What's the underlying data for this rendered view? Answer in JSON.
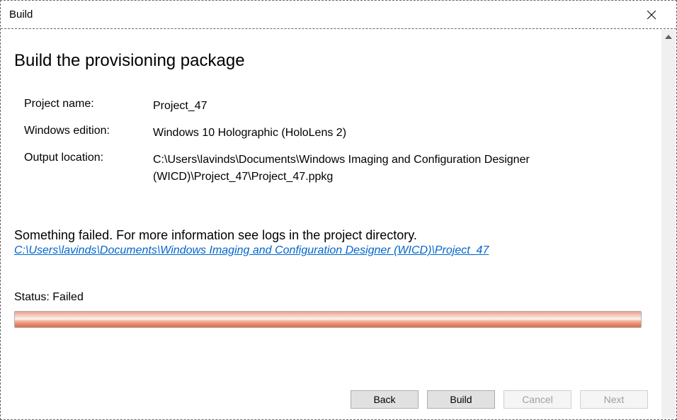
{
  "window": {
    "title": "Build"
  },
  "heading": "Build the provisioning package",
  "info": {
    "project_name_label": "Project name:",
    "project_name_value": "Project_47",
    "windows_edition_label": "Windows edition:",
    "windows_edition_value": "Windows 10 Holographic (HoloLens 2)",
    "output_location_label": "Output location:",
    "output_location_value": "C:\\Users\\lavinds\\Documents\\Windows Imaging and Configuration Designer (WICD)\\Project_47\\Project_47.ppkg"
  },
  "error": {
    "message": "Something failed. For more information see logs in the project directory.",
    "log_link": "C:\\Users\\lavinds\\Documents\\Windows Imaging and Configuration Designer (WICD)\\Project_47"
  },
  "status": {
    "label": "Status:",
    "value": "Failed"
  },
  "buttons": {
    "back": "Back",
    "build": "Build",
    "cancel": "Cancel",
    "next": "Next"
  }
}
